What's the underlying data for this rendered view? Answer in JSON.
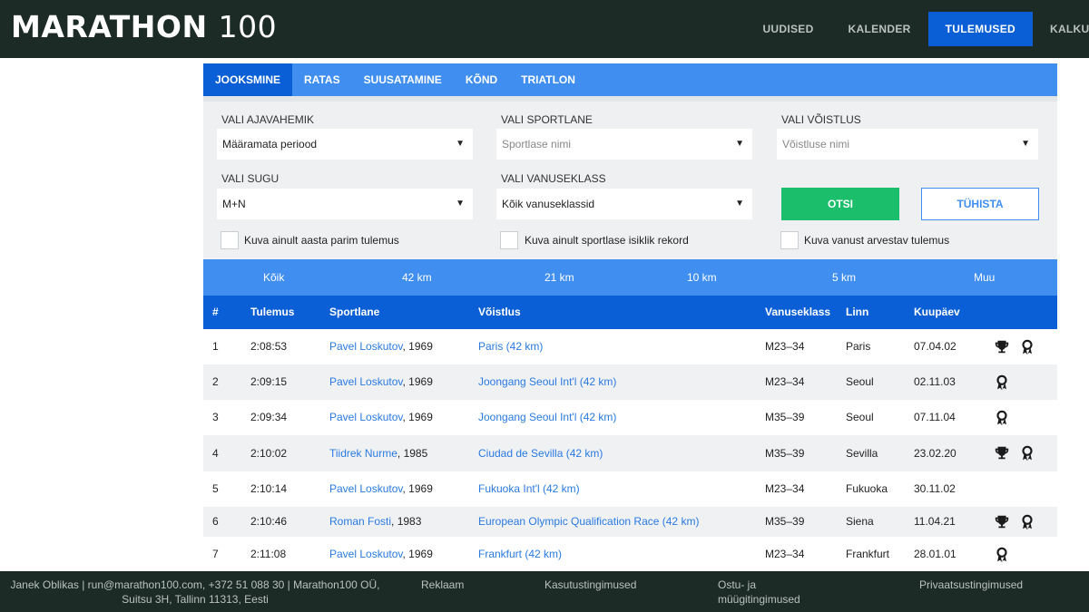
{
  "header": {
    "logo_word": "MARATHON",
    "logo_num": "100",
    "nav": [
      "UUDISED",
      "KALENDER",
      "TULEMUSED",
      "KALKULA"
    ],
    "active_nav": "TULEMUSED"
  },
  "sport_tabs": [
    "JOOKSMINE",
    "RATAS",
    "SUUSATAMINE",
    "KÕND",
    "TRIATLON"
  ],
  "filters": {
    "period_label": "VALI AJAVAHEMIK",
    "period_value": "Määramata periood",
    "athlete_label": "VALI SPORTLANE",
    "athlete_placeholder": "Sportlase nimi",
    "race_label": "VALI VÕISTLUS",
    "race_placeholder": "Võistluse nimi",
    "gender_label": "VALI SUGU",
    "gender_value": "M+N",
    "age_label": "VALI VANUSEKLASS",
    "age_value": "Kõik vanuseklassid",
    "search_button": "OTSI",
    "clear_button": "TÜHISTA",
    "checkbox_best_year": "Kuva ainult aasta parim tulemus",
    "checkbox_personal_record": "Kuva ainult sportlase isiklik rekord",
    "checkbox_age_graded": "Kuva vanust arvestav tulemus",
    "caret": "▼"
  },
  "distance_tabs": [
    "Kõik",
    "42 km",
    "21 km",
    "10 km",
    "5 km",
    "Muu"
  ],
  "table": {
    "headers": [
      "#",
      "Tulemus",
      "Sportlane",
      "Võistlus",
      "Vanuseklass",
      "Linn",
      "Kuupäev"
    ],
    "rows": [
      {
        "n": "1",
        "time": "2:08:53",
        "athlete": "Pavel Loskutov",
        "year": ", 1969",
        "race": "Paris (42 km)",
        "age": "M23–34",
        "city": "Paris",
        "date": "07.04.02",
        "trophy": true,
        "medal": true
      },
      {
        "n": "2",
        "time": "2:09:15",
        "athlete": "Pavel Loskutov",
        "year": ", 1969",
        "race": "Joongang Seoul Int'l (42 km)",
        "age": "M23–34",
        "city": "Seoul",
        "date": "02.11.03",
        "trophy": false,
        "medal": true
      },
      {
        "n": "3",
        "time": "2:09:34",
        "athlete": "Pavel Loskutov",
        "year": ", 1969",
        "race": "Joongang Seoul Int'l (42 km)",
        "age": "M35–39",
        "city": "Seoul",
        "date": "07.11.04",
        "trophy": false,
        "medal": true
      },
      {
        "n": "4",
        "time": "2:10:02",
        "athlete": "Tiidrek Nurme",
        "year": ", 1985",
        "race": "Ciudad de Sevilla (42 km)",
        "age": "M35–39",
        "city": "Sevilla",
        "date": "23.02.20",
        "trophy": true,
        "medal": true
      },
      {
        "n": "5",
        "time": "2:10:14",
        "athlete": "Pavel Loskutov",
        "year": ", 1969",
        "race": "Fukuoka Int'l (42 km)",
        "age": "M23–34",
        "city": "Fukuoka",
        "date": "30.11.02",
        "trophy": false,
        "medal": false
      },
      {
        "n": "6",
        "time": "2:10:46",
        "athlete": "Roman Fosti",
        "year": ", 1983",
        "race": "European Olympic Qualification Race (42 km)",
        "age": "M35–39",
        "city": "Siena",
        "date": "11.04.21",
        "trophy": true,
        "medal": true
      },
      {
        "n": "7",
        "time": "2:11:08",
        "athlete": "Pavel Loskutov",
        "year": ", 1969",
        "race": "Frankfurt (42 km)",
        "age": "M23–34",
        "city": "Frankfurt",
        "date": "28.01.01",
        "trophy": false,
        "medal": true
      }
    ]
  },
  "footer": {
    "contact_line1": "Janek Oblikas | run@marathon100.com, +372 51 088 30 | Marathon100 OÜ,",
    "contact_line2": "Suitsu 3H, Tallinn 11313, Eesti",
    "ads": "Reklaam",
    "terms": "Kasutustingimused",
    "sales_line1": "Ostu- ja",
    "sales_line2": "müügitingimused",
    "privacy": "Privaatsustingimused"
  },
  "colors": {
    "dark_bar": "#1d2b27",
    "primary_blue": "#0a5fd6",
    "light_blue": "#3f8ef0",
    "green": "#1bbe6b",
    "link": "#2a7ae2"
  },
  "icon_names": [
    "trophy-icon",
    "medal-icon",
    "dropdown-caret-icon"
  ]
}
